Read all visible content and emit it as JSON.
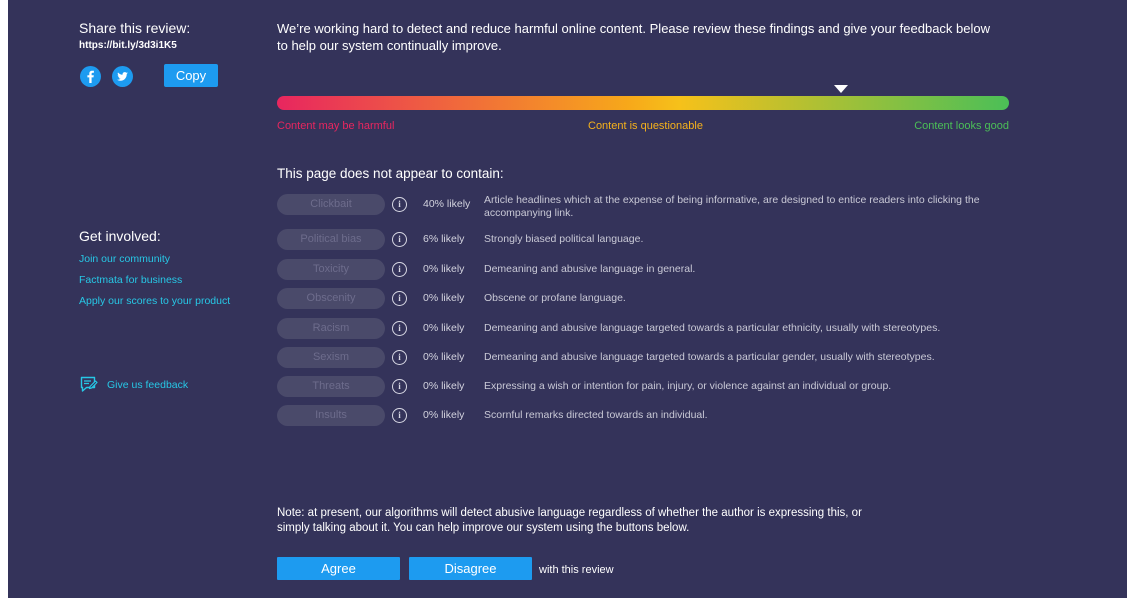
{
  "sidebar": {
    "share_title": "Share this review:",
    "share_url": "https://bit.ly/3d3i1K5",
    "copy_label": "Copy",
    "involved_title": "Get involved:",
    "links": [
      {
        "label": "Join our community"
      },
      {
        "label": "Factmata for business"
      },
      {
        "label": "Apply our scores to your product"
      }
    ],
    "feedback_label": "Give us feedback",
    "icons": [
      "facebook-icon",
      "twitter-icon",
      "feedback-icon"
    ]
  },
  "main": {
    "intro": "We’re working hard to detect and reduce harmful online content. Please review these findings and give your feedback below to help our system continually improve.",
    "scale": {
      "harmful": "Content may be harmful",
      "questionable": "Content is questionable",
      "good": "Content looks good",
      "marker_position": 0.77
    },
    "contains_title": "This page does not appear to contain:",
    "categories": [
      {
        "name": "Clickbait",
        "likely": "40% likely",
        "desc": "Article headlines which at the expense of being informative, are designed to entice readers into clicking the accompanying link."
      },
      {
        "name": "Political bias",
        "likely": "6% likely",
        "desc": "Strongly biased political language."
      },
      {
        "name": "Toxicity",
        "likely": "0% likely",
        "desc": "Demeaning and abusive language in general."
      },
      {
        "name": "Obscenity",
        "likely": "0% likely",
        "desc": "Obscene or profane language."
      },
      {
        "name": "Racism",
        "likely": "0% likely",
        "desc": "Demeaning and abusive language targeted towards a particular ethnicity, usually with stereotypes."
      },
      {
        "name": "Sexism",
        "likely": "0% likely",
        "desc": "Demeaning and abusive language targeted towards a particular gender, usually with stereotypes."
      },
      {
        "name": "Threats",
        "likely": "0% likely",
        "desc": "Expressing a wish or intention for pain, injury, or violence against an individual or group."
      },
      {
        "name": "Insults",
        "likely": "0% likely",
        "desc": "Scornful remarks directed towards an individual."
      }
    ],
    "note": "Note: at present, our algorithms will detect abusive language regardless of whether the author is expressing this, or simply talking about it. You can help improve our system using the buttons below.",
    "agree_label": "Agree",
    "disagree_label": "Disagree",
    "with_review": "with this review"
  },
  "colors": {
    "background": "#34335a",
    "accent": "#1d9bf0",
    "link": "#27c8e6",
    "harmful": "#e8265f",
    "questionable": "#f6b21b",
    "good": "#4bbf57"
  }
}
